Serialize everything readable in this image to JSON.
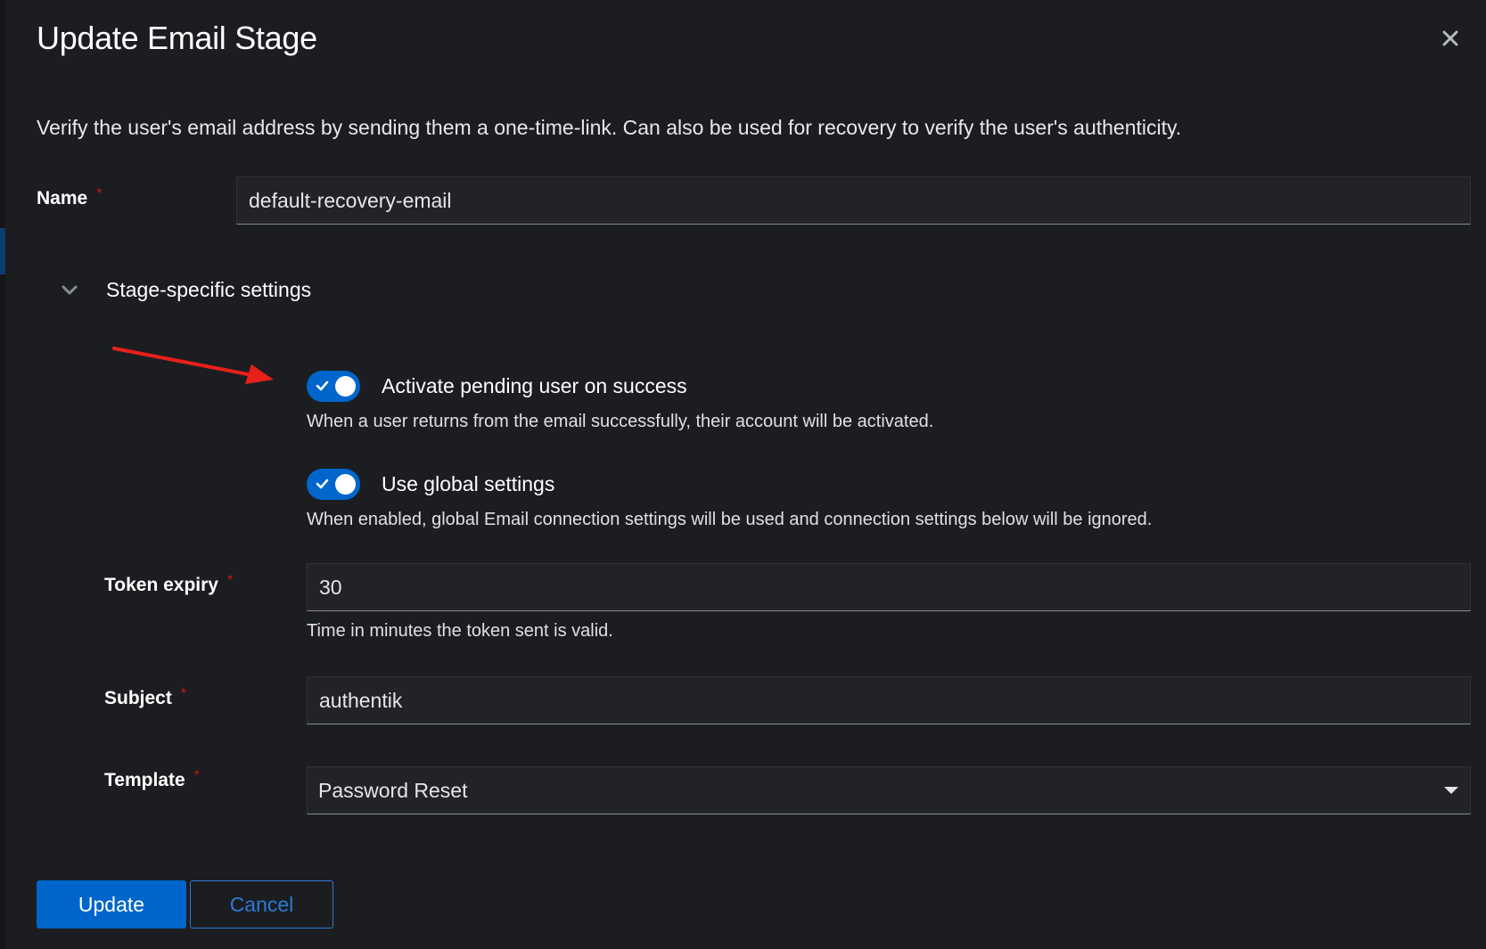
{
  "modal": {
    "title": "Update Email Stage",
    "close_icon": "close-icon",
    "description": "Verify the user's email address by sending them a one-time-link. Can also be used for recovery to verify the user's authenticity."
  },
  "form": {
    "name": {
      "label": "Name",
      "required": "*",
      "value": "default-recovery-email"
    },
    "stage_settings": {
      "label": "Stage-specific settings",
      "expanded": true,
      "icon": "chevron-down-icon"
    },
    "activate_pending": {
      "label": "Activate pending user on success",
      "checked": true,
      "helper": "When a user returns from the email successfully, their account will be activated."
    },
    "use_global": {
      "label": "Use global settings",
      "checked": true,
      "helper": "When enabled, global Email connection settings will be used and connection settings below will be ignored."
    },
    "token_expiry": {
      "label": "Token expiry",
      "required": "*",
      "value": "30",
      "helper": "Time in minutes the token sent is valid."
    },
    "subject": {
      "label": "Subject",
      "required": "*",
      "value": "authentik"
    },
    "template": {
      "label": "Template",
      "required": "*",
      "value": "Password Reset",
      "icon": "caret-down-icon"
    }
  },
  "actions": {
    "update_label": "Update",
    "cancel_label": "Cancel"
  },
  "annotation": {
    "icon": "red-arrow-icon",
    "color": "#e8201a"
  },
  "colors": {
    "accent": "#0066cc",
    "background": "#1b1d21",
    "required": "#c9190b"
  }
}
